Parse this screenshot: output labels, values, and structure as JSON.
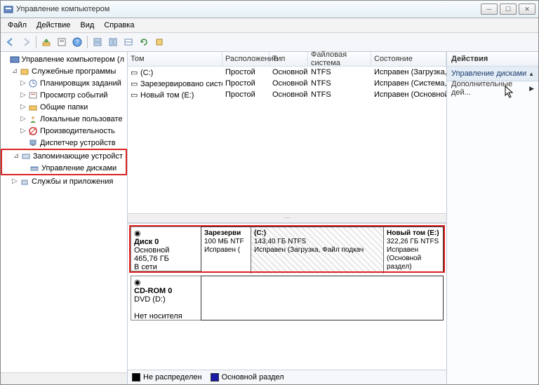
{
  "window": {
    "title": "Управление компьютером"
  },
  "menu": {
    "file": "Файл",
    "action": "Действие",
    "view": "Вид",
    "help": "Справка"
  },
  "tree": {
    "root": "Управление компьютером (л",
    "tools": "Служебные программы",
    "scheduler": "Планировщик заданий",
    "events": "Просмотр событий",
    "shares": "Общие папки",
    "users": "Локальные пользовате",
    "perf": "Производительность",
    "devmgr": "Диспетчер устройств",
    "storage": "Запоминающие устройст",
    "diskmgmt": "Управление дисками",
    "services": "Службы и приложения"
  },
  "volcols": {
    "vol": "Том",
    "layout": "Расположение",
    "type": "Тип",
    "fs": "Файловая система",
    "state": "Состояние"
  },
  "vols": [
    {
      "name": "(C:)",
      "layout": "Простой",
      "type": "Основной",
      "fs": "NTFS",
      "state": "Исправен (Загрузка, Фай"
    },
    {
      "name": "Зарезервировано системой",
      "layout": "Простой",
      "type": "Основной",
      "fs": "NTFS",
      "state": "Исправен (Система, Акти"
    },
    {
      "name": "Новый том (E:)",
      "layout": "Простой",
      "type": "Основной",
      "fs": "NTFS",
      "state": "Исправен (Основной раз"
    }
  ],
  "disk0": {
    "name": "Диск 0",
    "type": "Основной",
    "size": "465,76 ГБ",
    "status": "В сети",
    "parts": [
      {
        "title": "Зарезерви",
        "line2": "100 МБ NTF",
        "line3": "Исправен ("
      },
      {
        "title": "(C:)",
        "line2": "143,40 ГБ NTFS",
        "line3": "Исправен (Загрузка, Файл подкач"
      },
      {
        "title": "Новый том  (E:)",
        "line2": "322,26 ГБ NTFS",
        "line3": "Исправен (Основной раздел)"
      }
    ]
  },
  "cdrom": {
    "name": "CD-ROM 0",
    "type": "DVD (D:)",
    "status": "Нет носителя"
  },
  "legend": {
    "unalloc": "Не распределен",
    "primary": "Основной раздел"
  },
  "actions": {
    "title": "Действия",
    "section": "Управление дисками",
    "more": "Дополнительные дей..."
  }
}
